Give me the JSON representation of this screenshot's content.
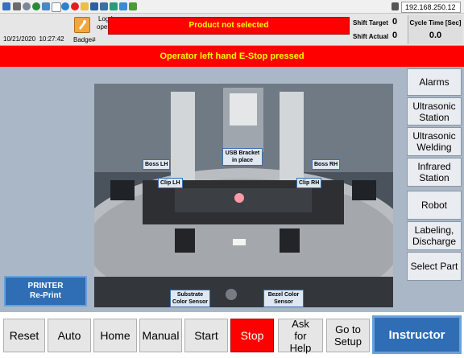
{
  "taskbar": {
    "ip_address": "192.168.250.12"
  },
  "header": {
    "datetime": "10/21/2020  10:27:42",
    "login_label": "Log In:",
    "login_user": "operator",
    "badge_label": "Badge#",
    "alert": "Product not selected",
    "shift_target_label": "Shift Target",
    "shift_target_value": "0",
    "shift_actual_label": "Shift Actual",
    "shift_actual_value": "0",
    "cycle_time_label": "Cycle Time [Sec]",
    "cycle_time_value": "0.0"
  },
  "banner": {
    "estop": "Operator left hand E-Stop pressed"
  },
  "camera": {
    "labels": {
      "boss_lh": "Boss LH",
      "usb_bracket": "USB Bracket in place",
      "boss_rh": "Boss RH",
      "clip_lh": "Clip LH",
      "clip_rh": "Clip RH",
      "substrate": "Substrate Color Sensor",
      "bezel": "Bezel Color Sensor"
    }
  },
  "side_menu": [
    {
      "label": "Alarms"
    },
    {
      "label": "Ultrasonic Station"
    },
    {
      "label": "Ultrasonic Welding"
    },
    {
      "label": "Infrared Station"
    },
    {
      "label": "Robot"
    },
    {
      "label": "Labeling, Discharge"
    },
    {
      "label": "Select Part"
    }
  ],
  "printer": {
    "line1": "PRINTER",
    "line2": "Re-Print"
  },
  "toolbar": {
    "reset": "Reset",
    "auto": "Auto",
    "home": "Home",
    "manual": "Manual",
    "start": "Start",
    "stop": "Stop",
    "ask_help": "Ask for Help",
    "goto_setup": "Go to Setup",
    "instructor": "Instructor"
  },
  "colors": {
    "alert_red": "#ff0000",
    "alert_text": "#ffff00",
    "main_bg": "#a9b7c6",
    "instructor_blue": "#2f6db5"
  }
}
